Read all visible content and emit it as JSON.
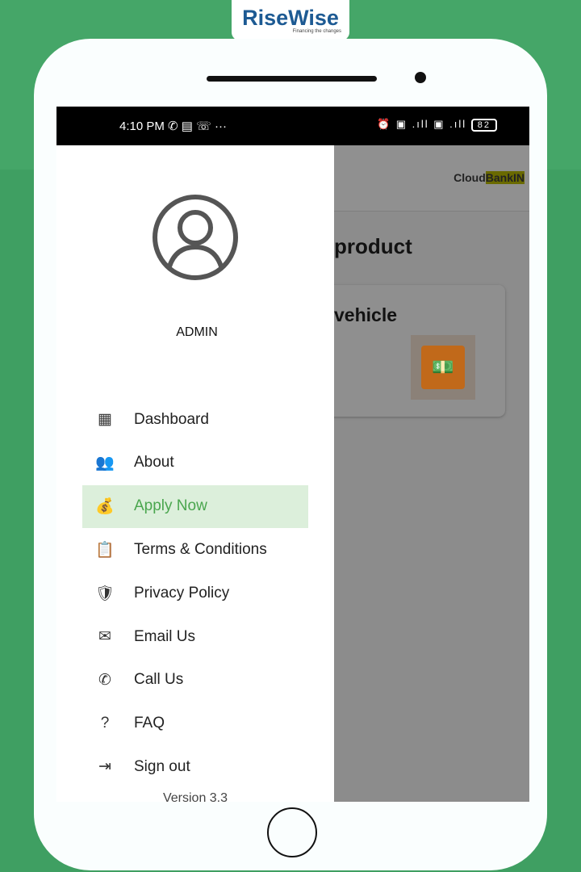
{
  "brand": {
    "name": "RiseWise",
    "tagline": "Financing the changes"
  },
  "status_bar": {
    "time": "4:10 PM",
    "icons": [
      "whatsapp-icon",
      "message-icon",
      "missed-call-icon",
      "more-icon"
    ],
    "right_icons": [
      "alarm-icon",
      "volte-icon",
      "signal-icon",
      "volte-icon",
      "4g-signal-icon"
    ],
    "battery": "82"
  },
  "background_app": {
    "logo_a": "Cloud",
    "logo_b": "BankIN",
    "heading": "product",
    "card_title": "vehicle"
  },
  "drawer": {
    "user": "ADMIN",
    "selected": "Apply Now",
    "items": [
      {
        "label": "Dashboard",
        "icon": "grid-icon",
        "glyph": "▦"
      },
      {
        "label": "About",
        "icon": "group-icon",
        "glyph": "👥"
      },
      {
        "label": "Apply Now",
        "icon": "money-bag-icon",
        "glyph": "💰"
      },
      {
        "label": "Terms & Conditions",
        "icon": "document-check-icon",
        "glyph": "📋"
      },
      {
        "label": "Privacy Policy",
        "icon": "shield-document-icon",
        "glyph": "🛡"
      },
      {
        "label": "Email Us",
        "icon": "envelope-icon",
        "glyph": "✉"
      },
      {
        "label": "Call Us",
        "icon": "phone-icon",
        "glyph": "✆"
      },
      {
        "label": "FAQ",
        "icon": "question-icon",
        "glyph": "?"
      },
      {
        "label": "Sign out",
        "icon": "exit-door-icon",
        "glyph": "⇥"
      }
    ],
    "version": "Version 3.3"
  },
  "colors": {
    "accent": "#4aa64e",
    "highlight": "#dcefdb",
    "brand": "#1d5a93",
    "background": "#3f9f62"
  }
}
